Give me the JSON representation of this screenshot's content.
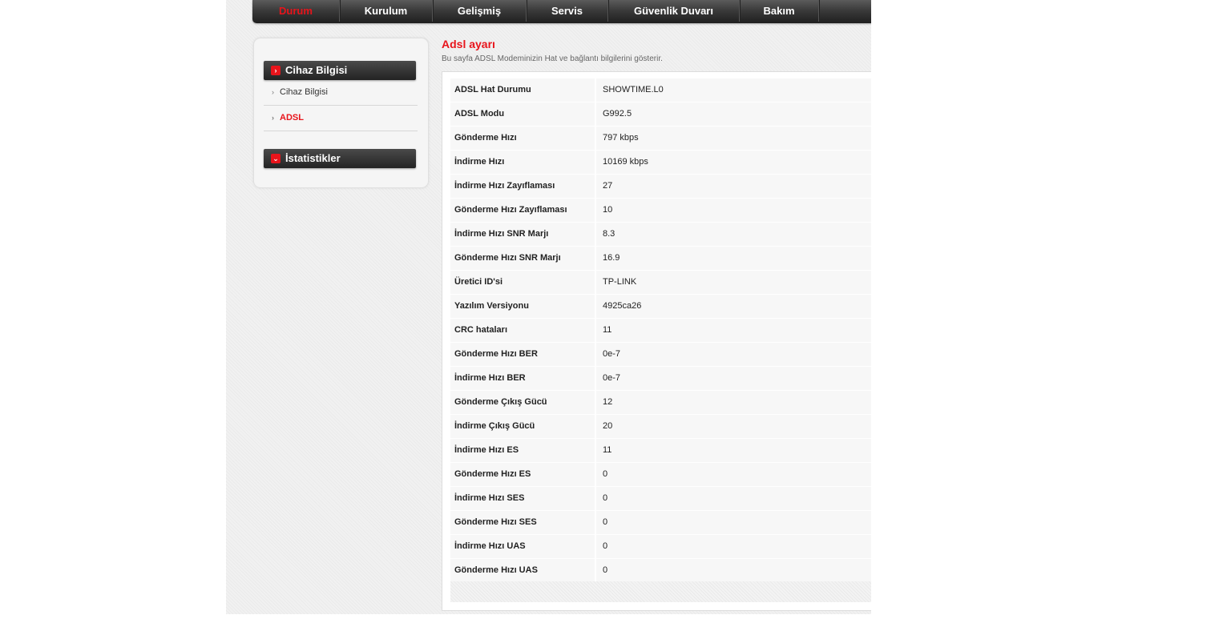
{
  "nav": {
    "items": [
      {
        "label": "Durum",
        "active": true
      },
      {
        "label": "Kurulum",
        "active": false
      },
      {
        "label": "Gelişmiş",
        "active": false
      },
      {
        "label": "Servis",
        "active": false
      },
      {
        "label": "Güvenlik Duvarı",
        "active": false
      },
      {
        "label": "Bakım",
        "active": false
      }
    ]
  },
  "sidebar": {
    "sections": [
      {
        "title": "Cihaz Bilgisi",
        "icon": "chevron-right-icon",
        "expanded": true,
        "items": [
          {
            "label": "Cihaz Bilgisi",
            "active": false
          },
          {
            "label": "ADSL",
            "active": true
          }
        ]
      },
      {
        "title": "İstatistikler",
        "icon": "chevron-down-icon",
        "expanded": false,
        "items": []
      }
    ]
  },
  "main": {
    "title": "Adsl ayarı",
    "description": "Bu sayfa ADSL Modeminizin Hat ve bağlantı bilgilerini gösterir.",
    "rows": [
      {
        "label": "ADSL Hat Durumu",
        "value": "SHOWTIME.L0"
      },
      {
        "label": "ADSL Modu",
        "value": "G992.5"
      },
      {
        "label": "Gönderme Hızı",
        "value": "797 kbps"
      },
      {
        "label": "İndirme Hızı",
        "value": "10169 kbps"
      },
      {
        "label": "İndirme Hızı Zayıflaması",
        "value": "27"
      },
      {
        "label": "Gönderme Hızı Zayıflaması",
        "value": "10"
      },
      {
        "label": "İndirme Hızı SNR Marjı",
        "value": "8.3"
      },
      {
        "label": "Gönderme Hızı SNR Marjı",
        "value": "16.9"
      },
      {
        "label": "Üretici ID'si",
        "value": "TP-LINK"
      },
      {
        "label": "Yazılım Versiyonu",
        "value": "4925ca26"
      },
      {
        "label": "CRC hataları",
        "value": "11"
      },
      {
        "label": "Gönderme Hızı BER",
        "value": "0e-7"
      },
      {
        "label": "İndirme Hızı BER",
        "value": "0e-7"
      },
      {
        "label": "Gönderme Çıkış Gücü",
        "value": "12"
      },
      {
        "label": "İndirme Çıkış Gücü",
        "value": "20"
      },
      {
        "label": "İndirme Hızı ES",
        "value": "11"
      },
      {
        "label": "Gönderme Hızı ES",
        "value": "0"
      },
      {
        "label": "İndirme Hızı SES",
        "value": "0"
      },
      {
        "label": "Gönderme Hızı SES",
        "value": "0"
      },
      {
        "label": "İndirme Hızı UAS",
        "value": "0"
      },
      {
        "label": "Gönderme Hızı UAS",
        "value": "0"
      }
    ]
  },
  "colors": {
    "accent": "#e8141b",
    "nav_bg": "#2a2a2a",
    "page_bg": "#f1f1f1"
  }
}
